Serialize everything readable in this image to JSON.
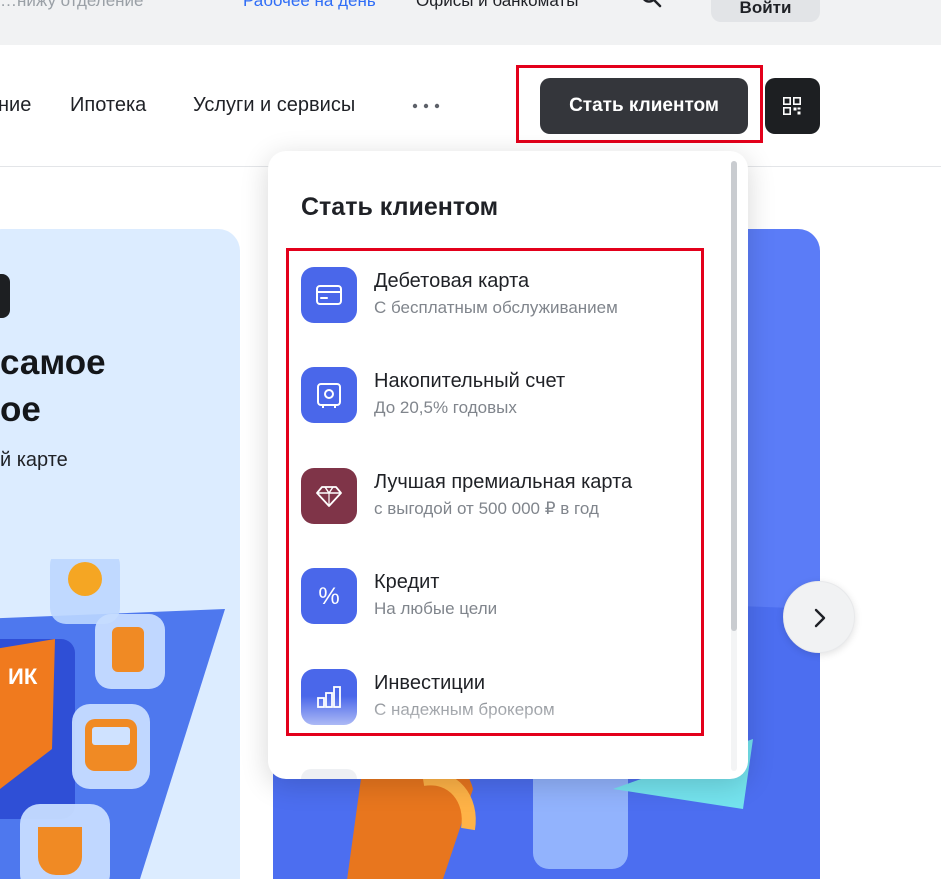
{
  "topbar": {
    "left_text": "…нижу отделение",
    "middle_link": "Рабочее на день",
    "right_text": "Офисы и банкоматы",
    "login_label": "Войти"
  },
  "nav": {
    "items": [
      "ние",
      "Ипотека",
      "Услуги и сервисы"
    ],
    "more_icon": "more-dots-icon",
    "cta_label": "Стать клиентом",
    "qr_icon": "qr-code-icon",
    "cta_highlight_color": "#e3001b"
  },
  "banner_left": {
    "headline_line1": "самое",
    "headline_line2": "ое",
    "subline": "й карте",
    "badge_text": "ИК"
  },
  "dropdown": {
    "title": "Стать клиентом",
    "highlight_color": "#e3001b",
    "items": [
      {
        "label": "Дебетовая карта",
        "sub": "С бесплатным обслуживанием",
        "icon": "card-icon",
        "color": "#4a67ea"
      },
      {
        "label": "Накопительный счет",
        "sub": "До 20,5% годовых",
        "icon": "safe-icon",
        "color": "#4a67ea"
      },
      {
        "label": "Лучшая премиальная карта",
        "sub": "с выгодой от 500 000 ₽ в год",
        "icon": "diamond-icon",
        "color": "#7f3448"
      },
      {
        "label": "Кредит",
        "sub": "На любые цели",
        "icon": "percent-icon",
        "color": "#4a67ea"
      },
      {
        "label": "Инвестиции",
        "sub": "С надежным брокером",
        "icon": "chart-bars-icon",
        "color": "#4a67ea"
      }
    ]
  },
  "carousel": {
    "next_icon": "chevron-right-icon"
  }
}
